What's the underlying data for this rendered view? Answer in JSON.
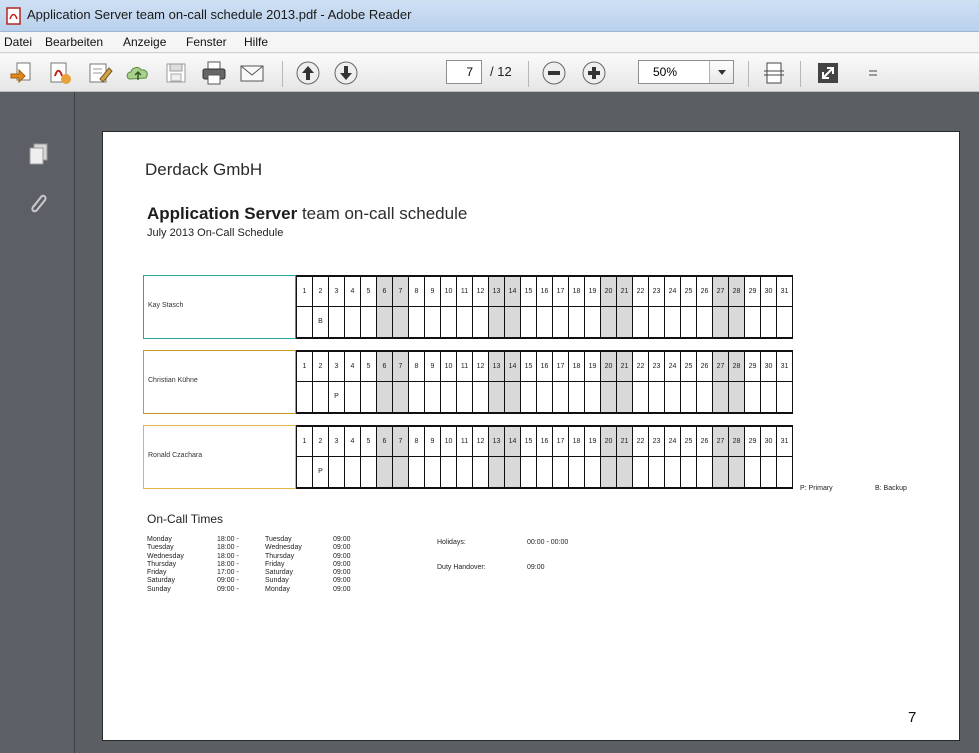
{
  "window": {
    "title": "Application Server team on-call schedule 2013.pdf - Adobe Reader"
  },
  "menu": [
    "Datei",
    "Bearbeiten",
    "Anzeige",
    "Fenster",
    "Hilfe"
  ],
  "toolbar": {
    "page_current": "7",
    "page_total": "/ 12",
    "zoom": "50%"
  },
  "document": {
    "company": "Derdack GmbH",
    "title_bold": "Application Server",
    "title_rest": " team on-call schedule",
    "subtitle": "July 2013 On-Call Schedule",
    "days": [
      "1",
      "2",
      "3",
      "4",
      "5",
      "6",
      "7",
      "8",
      "9",
      "10",
      "11",
      "12",
      "13",
      "14",
      "15",
      "16",
      "17",
      "18",
      "19",
      "20",
      "21",
      "22",
      "23",
      "24",
      "25",
      "26",
      "27",
      "28",
      "29",
      "30",
      "31"
    ],
    "weekend_days": [
      6,
      7,
      13,
      14,
      20,
      21,
      27,
      28
    ],
    "people": [
      {
        "name": "Kay Stasch",
        "color": "#27a89a",
        "duty": {
          "2": "B"
        }
      },
      {
        "name": "Christian Kühne",
        "color": "#c79a22",
        "duty": {
          "3": "P"
        }
      },
      {
        "name": "Ronald Czachara",
        "color": "#e0b54a",
        "duty": {
          "2": "P"
        }
      }
    ],
    "legend_primary": "P: Primary",
    "legend_backup": "B: Backup",
    "oncall_heading": "On-Call Times",
    "oncall_times": [
      [
        "Monday",
        "18:00 -",
        "Tuesday",
        "09:00"
      ],
      [
        "Tuesday",
        "18:00 -",
        "Wednesday",
        "09:00"
      ],
      [
        "Wednesday",
        "18:00 -",
        "Thursday",
        "09:00"
      ],
      [
        "Thursday",
        "18:00 -",
        "Friday",
        "09:00"
      ],
      [
        "Friday",
        "17:00 -",
        "Saturday",
        "09:00"
      ],
      [
        "Saturday",
        "09:00 -",
        "Sunday",
        "09:00"
      ],
      [
        "Sunday",
        "09:00 -",
        "Monday",
        "09:00"
      ]
    ],
    "holidays_label": "Holidays:",
    "holidays_value": "00:00 - 00:00",
    "handover_label": "Duty Handover:",
    "handover_value": "09:00",
    "page_number": "7"
  }
}
